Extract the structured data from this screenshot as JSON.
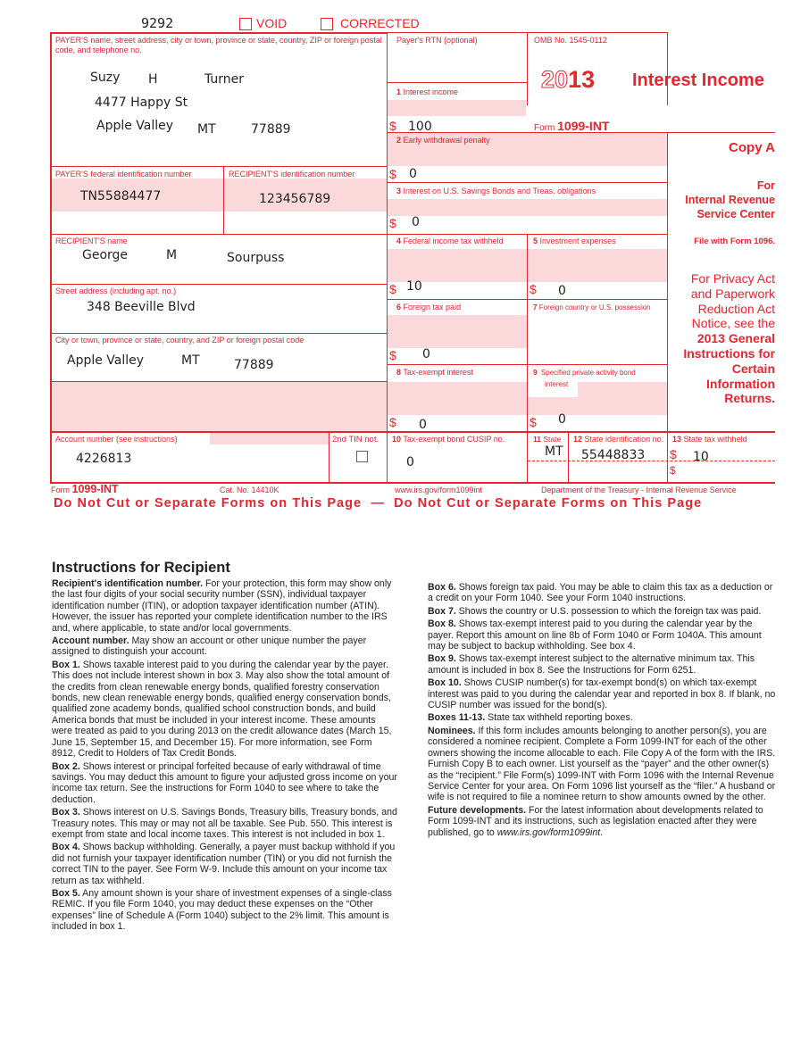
{
  "header": {
    "control_number": "9292",
    "void_label": "VOID",
    "corrected_label": "CORRECTED"
  },
  "payer": {
    "label": "PAYER'S name, street address, city or town, province or state, country, ZIP or foreign postal code, and telephone no.",
    "first_name": "Suzy",
    "middle_initial": "H",
    "last_name": "Turner",
    "street": "4477 Happy St",
    "city": "Apple Valley",
    "state": "MT",
    "zip": "77889"
  },
  "rtn": {
    "label": "Payer's RTN (optional)"
  },
  "omb": {
    "label": "OMB No. 1545-0112",
    "year_outline": "20",
    "year_bold": "13",
    "form_prefix": "Form",
    "form_name": "1099-INT"
  },
  "title": "Interest Income",
  "copy": {
    "copy_label": "Copy A",
    "for_line1": "For",
    "for_line2": "Internal Revenue",
    "for_line3": "Service Center",
    "file_with": "File with Form 1096.",
    "privacy": [
      "For Privacy Act",
      "and Paperwork",
      "Reduction Act",
      "Notice, see the"
    ],
    "privacy_bold": [
      "2013 General",
      "Instructions for",
      "Certain",
      "Information",
      "Returns."
    ]
  },
  "ids": {
    "payer_fed_id_label": "PAYER'S federal identification number",
    "payer_fed_id": "TN55884477",
    "recipient_id_label": "RECIPIENT'S identification number",
    "recipient_id": "123456789"
  },
  "recipient": {
    "name_label": "RECIPIENT'S name",
    "first_name": "George",
    "middle_initial": "M",
    "last_name": "Sourpuss",
    "street_label": "Street address (including apt. no.)",
    "street": "348 Beeville Blvd",
    "city_label": "City or town, province or state, country, and ZIP or foreign postal code",
    "city": "Apple Valley",
    "state": "MT",
    "zip": "77889"
  },
  "boxes": {
    "dollar": "$",
    "b1": {
      "num": "1",
      "label": "Interest income",
      "value": "100"
    },
    "b2": {
      "num": "2",
      "label": "Early withdrawal penalty",
      "value": "0"
    },
    "b3": {
      "num": "3",
      "label": "Interest on U.S. Savings Bonds and Treas. obligations",
      "value": "0"
    },
    "b4": {
      "num": "4",
      "label": "Federal income tax withheld",
      "value": "10"
    },
    "b5": {
      "num": "5",
      "label": "Investment expenses",
      "value": "0"
    },
    "b6": {
      "num": "6",
      "label": "Foreign tax paid",
      "value": "0"
    },
    "b7": {
      "num": "7",
      "label": "Foreign country or U.S. possession",
      "value": ""
    },
    "b8": {
      "num": "8",
      "label": "Tax-exempt interest",
      "value": "0"
    },
    "b9": {
      "num": "9",
      "label": "Specified private activity bond",
      "label2": "interest",
      "value": "0"
    },
    "b10": {
      "num": "10",
      "label": "Tax-exempt bond CUSIP no.",
      "value": "0"
    },
    "b11": {
      "num": "11",
      "label": "State",
      "value": "MT"
    },
    "b12": {
      "num": "12",
      "label": "State identification no.",
      "value": "55448833"
    },
    "b13": {
      "num": "13",
      "label": "State tax withheld",
      "value": "10"
    }
  },
  "account": {
    "label": "Account number (see instructions)",
    "value": "4226813",
    "second_tin_label": "2nd TIN not."
  },
  "footer": {
    "form_prefix": "Form",
    "form_name": "1099-INT",
    "cat_no": "Cat. No. 14410K",
    "url": "www.irs.gov/form1099int",
    "dept": "Department of the Treasury - Internal Revenue Service",
    "do_not_cut": "Do Not Cut or Separate Forms on This Page",
    "dash": "—"
  },
  "instructions": {
    "heading": "Instructions for Recipient",
    "left": [
      {
        "title": "Recipient's identification number.",
        "body": " For your protection, this form may show only the last four digits of your social security number (SSN), individual taxpayer identification number (ITIN), or adoption taxpayer identification number (ATIN). However, the issuer has reported your complete identification number to the IRS and, where applicable, to state and/or local governments."
      },
      {
        "title": "Account number.",
        "body": " May show an account or other unique number the payer assigned to distinguish your account."
      },
      {
        "title": "Box 1.",
        "body": " Shows taxable interest paid to you during the calendar year by the payer. This does not include interest shown in box 3. May also show the total amount of the credits from clean renewable energy bonds, qualified forestry conservation bonds, new clean renewable energy bonds, qualified energy conservation bonds, qualified zone academy bonds, qualified school construction bonds, and build America bonds that must be included in your interest income. These amounts were treated as paid to you during 2013 on the credit allowance dates (March 15, June 15, September 15, and December 15). For more information, see Form 8912, Credit to Holders of Tax Credit Bonds."
      },
      {
        "title": "Box 2.",
        "body": " Shows interest or principal forfeited because of early withdrawal of time savings. You may deduct this amount to figure your adjusted gross income on your income tax return. See the instructions for Form 1040 to see where to take the deduction."
      },
      {
        "title": "Box 3.",
        "body": " Shows interest on U.S. Savings Bonds, Treasury bills, Treasury bonds, and Treasury notes. This may or may not all be taxable. See Pub. 550. This interest is exempt from state and local income taxes. This interest is not included in box 1."
      },
      {
        "title": "Box 4.",
        "body": " Shows backup withholding. Generally, a payer must backup withhold if you did not furnish your taxpayer identification number (TIN) or you did not furnish the correct TIN to the payer. See Form W-9. Include this amount on your income tax return as tax withheld."
      },
      {
        "title": "Box 5.",
        "body": " Any amount shown is your share of investment expenses of a single-class REMIC. If you file Form 1040, you may deduct these expenses on the “Other expenses” line of Schedule A (Form 1040) subject to the 2% limit. This amount is included in box 1."
      }
    ],
    "right": [
      {
        "title": "Box 6.",
        "body": " Shows foreign tax paid. You may be able to claim this tax as a deduction or a credit on your Form 1040. See your Form 1040 instructions."
      },
      {
        "title": "Box 7.",
        "body": " Shows the country or U.S. possession to which the foreign tax was paid."
      },
      {
        "title": "Box 8.",
        "body": " Shows tax-exempt interest paid to you during the calendar year by the payer. Report this amount on line 8b of Form 1040 or Form 1040A. This amount may be subject to backup withholding. See box 4."
      },
      {
        "title": "Box 9.",
        "body": " Shows tax-exempt interest subject to the alternative minimum tax. This amount is included in box 8. See the Instructions for Form 6251."
      },
      {
        "title": "Box 10.",
        "body": " Shows CUSIP number(s) for tax-exempt bond(s) on which tax-exempt interest was paid to you during the calendar year and reported in box 8. If blank, no CUSIP number was issued for the bond(s)."
      },
      {
        "title": "Boxes 11-13.",
        "body": " State tax withheld reporting boxes."
      },
      {
        "title": "Nominees.",
        "body": " If this form includes amounts belonging to another person(s), you are considered a nominee recipient. Complete a Form 1099-INT for each of the other owners showing the income allocable to each. File Copy A of the form with the IRS. Furnish Copy B to each owner. List yourself as the “payer” and the other owner(s) as the “recipient.” File Form(s) 1099-INT with Form 1096 with the Internal Revenue Service Center for your area. On Form 1096 list yourself as the “filer.” A husband or wife is not required to file a nominee return to show amounts owned by the other."
      },
      {
        "title": "Future developments.",
        "body": " For the latest information about developments related to Form 1099-INT and its instructions, such as legislation enacted after they were published, go to ",
        "italic": "www.irs.gov/form1099int",
        "tail": "."
      }
    ]
  }
}
